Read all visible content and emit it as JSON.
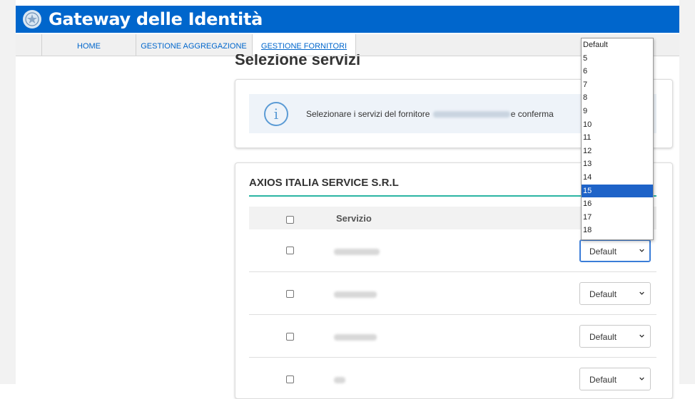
{
  "app": {
    "title": "Gateway delle Identità",
    "emblem_icon": "italian-republic-emblem-icon",
    "brand_color": "#0066cc"
  },
  "nav": {
    "items": [
      {
        "label": "HOME",
        "active": false
      },
      {
        "label": "GESTIONE AGGREGAZIONE",
        "active": false
      },
      {
        "label": "GESTIONE FORNITORI",
        "active": true
      }
    ]
  },
  "page": {
    "title": "Selezione servizi"
  },
  "info": {
    "icon": "info-icon",
    "text_prefix": "Selezionare i servizi del fornitore",
    "text_suffix": "e conferma"
  },
  "provider": {
    "name": "AXIOS ITALIA SERVICE S.R.L",
    "accent_color": "#2bb5a3"
  },
  "table": {
    "header": {
      "service_label": "Servizio"
    },
    "rows": [
      {
        "select_value": "Default",
        "focused": true
      },
      {
        "select_value": "Default",
        "focused": false
      },
      {
        "select_value": "Default",
        "focused": false
      },
      {
        "select_value": "Default",
        "focused": false
      }
    ]
  },
  "dropdown": {
    "options": [
      "Default",
      "5",
      "6",
      "7",
      "8",
      "9",
      "10",
      "11",
      "12",
      "13",
      "14",
      "15",
      "16",
      "17",
      "18"
    ],
    "highlighted": "15",
    "highlight_color": "#1e63c8"
  }
}
